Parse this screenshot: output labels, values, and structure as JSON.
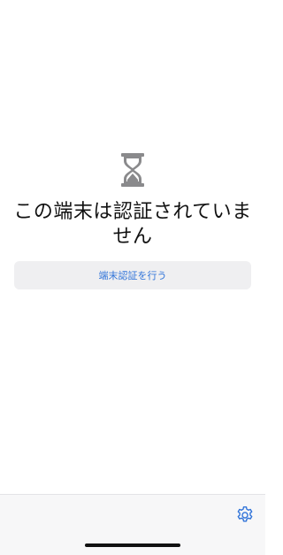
{
  "status": {
    "icon": "hourglass-icon",
    "message": "この端末は認証されていません"
  },
  "actions": {
    "authenticate_label": "端末認証を行う"
  },
  "toolbar": {
    "settings_icon": "gear-icon"
  },
  "colors": {
    "accent": "#2f73d9",
    "button_bg": "#efeff1",
    "bar_bg": "#f7f7f8",
    "icon_gray": "#8a8a8c"
  }
}
